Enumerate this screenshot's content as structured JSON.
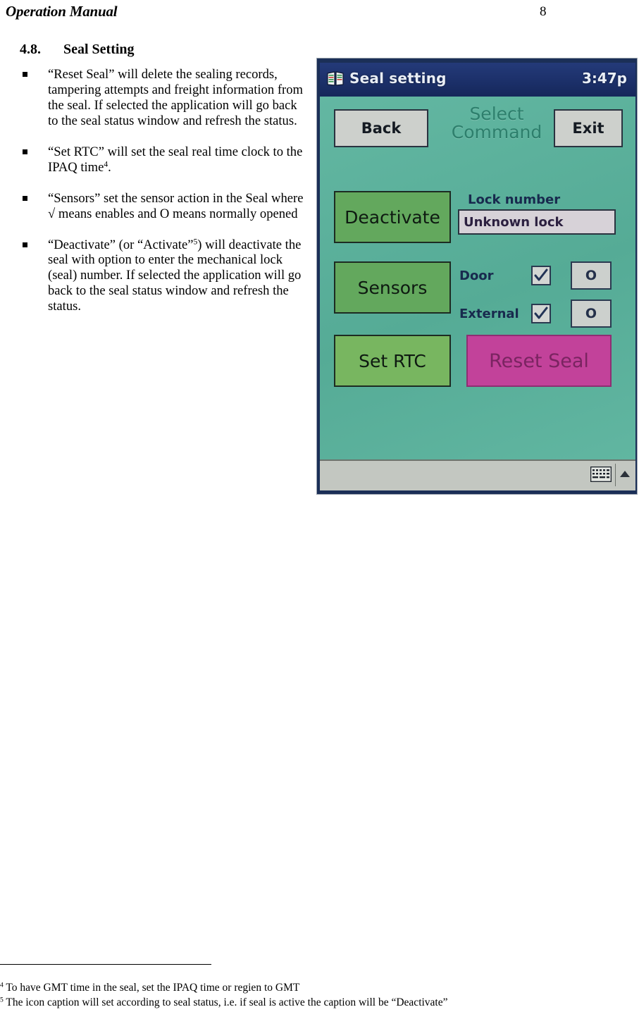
{
  "header": {
    "title": "Operation Manual",
    "page_number": "8"
  },
  "section": {
    "number": "4.8.",
    "title": "Seal Setting"
  },
  "bullets": [
    {
      "text": "“Reset Seal” will delete the sealing records, tampering attempts and freight information from the seal.  If selected the application will go back to the seal status window and refresh the status."
    },
    {
      "text_before": "“Set RTC” will set the seal real time clock to the IPAQ time",
      "footnote_ref": "4",
      "text_after": "."
    },
    {
      "text": "“Sensors” set the sensor action in the Seal where √ means enables and O means normally opened"
    },
    {
      "text_before": "“Deactivate” (or “Activate”",
      "footnote_ref": "5",
      "text_after": ") will deactivate the seal with option to enter the mechanical lock (seal) number. If selected the application will go back to the seal status window and refresh the status."
    }
  ],
  "pda": {
    "titlebar": {
      "app_icon": "app-book-icon",
      "title": "Seal setting",
      "clock": "3:47p"
    },
    "buttons": {
      "back": "Back",
      "exit": "Exit",
      "deactivate": "Deactivate",
      "sensors": "Sensors",
      "set_rtc": "Set RTC",
      "reset_seal": "Reset Seal"
    },
    "caption": "Select Command",
    "lock": {
      "label": "Lock number",
      "value": "Unknown lock"
    },
    "sensors": [
      {
        "label": "Door",
        "checked": "✓",
        "value": "O"
      },
      {
        "label": "External",
        "checked": "✓",
        "value": "O"
      }
    ],
    "taskbar": {
      "sip_icon": "keyboard-icon",
      "arrow_icon": "chevron-up-icon"
    },
    "colors": {
      "titlebar": "#1e3470",
      "client_bg": "#5fb49f",
      "button_green": "#63a85d",
      "button_green_light": "#78b660",
      "button_pink": "#c2429a",
      "button_gray": "#cdd0cc",
      "taskbar": "#c3c7c1",
      "caption_text": "#2d7f6c",
      "label_text": "#182a4e"
    }
  },
  "footnotes": [
    {
      "ref": "4",
      "text": "To have GMT time in the seal, set the IPAQ time or regien to GMT"
    },
    {
      "ref": "5",
      "text": "The icon caption will set according to seal status, i.e. if seal is active the caption will be “Deactivate”"
    }
  ]
}
